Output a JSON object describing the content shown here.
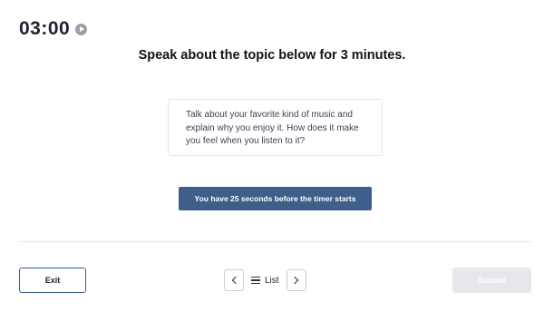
{
  "timer": {
    "time": "03:00",
    "icon": "play-icon"
  },
  "prompt": {
    "title": "Speak about the topic below for 3 minutes."
  },
  "topic": {
    "text": "Talk about your favorite kind of music and explain why you enjoy it. How does it make you feel when you listen to it?"
  },
  "banner": {
    "text": "You have 25 seconds before the timer starts"
  },
  "footer": {
    "exit_label": "Exit",
    "prev_icon": "chevron-left-icon",
    "list_icon": "list-icon",
    "list_label": "List",
    "next_icon": "chevron-right-icon",
    "submit_label": "Submit"
  },
  "colors": {
    "accent": "#3e5f8a",
    "submit_disabled": "#e6e8ec",
    "text": "#1d2230"
  }
}
